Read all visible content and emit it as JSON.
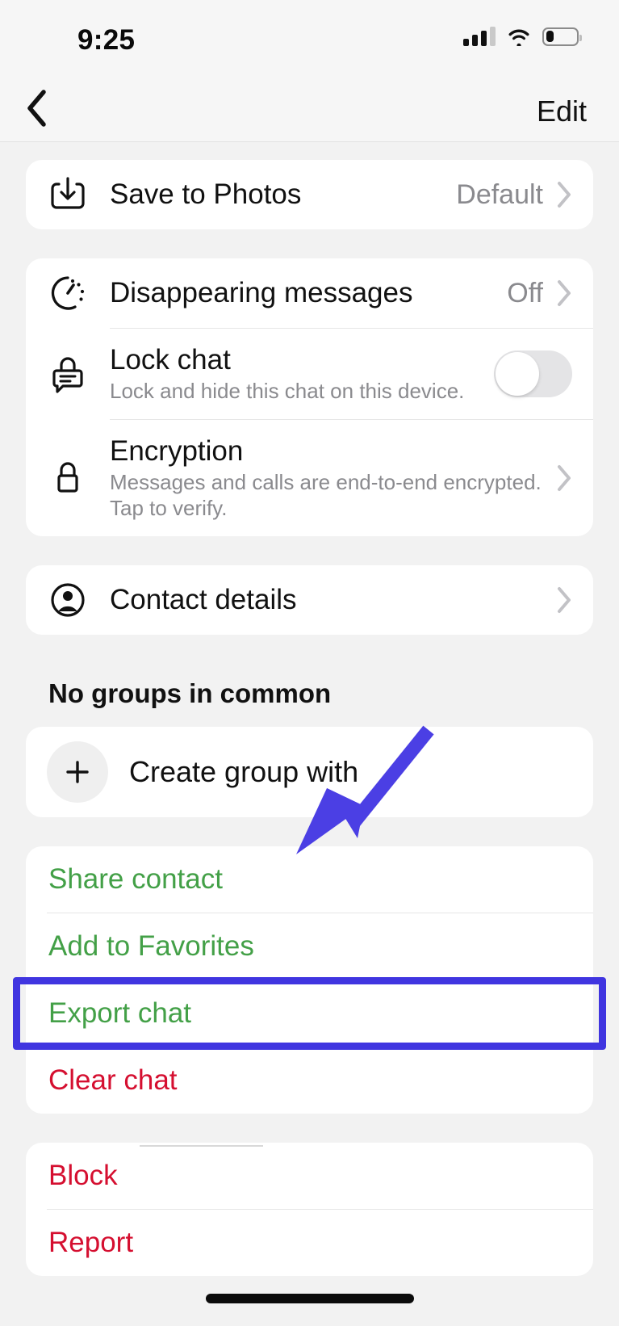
{
  "status_bar": {
    "time": "9:25",
    "icons": [
      "cellular-signal-icon",
      "wifi-icon",
      "battery-icon"
    ],
    "battery_level_percent": 25,
    "signal_bars_filled": 3,
    "signal_bars_total": 4
  },
  "nav_bar": {
    "back_icon": "chevron-left-icon",
    "edit_label": "Edit"
  },
  "sections": {
    "media": {
      "rows": [
        {
          "icon": "save-to-photos-icon",
          "title": "Save to Photos",
          "value": "Default",
          "accessory": "chevron-right-icon"
        }
      ]
    },
    "privacy": {
      "rows": [
        {
          "icon": "disappearing-messages-timer-icon",
          "title": "Disappearing messages",
          "value": "Off",
          "accessory": "chevron-right-icon"
        },
        {
          "icon": "lock-chat-icon",
          "title": "Lock chat",
          "subtitle": "Lock and hide this chat on this device.",
          "accessory": "toggle-switch",
          "toggle_state": "off"
        },
        {
          "icon": "encryption-lock-icon",
          "title": "Encryption",
          "subtitle": "Messages and calls are end-to-end encrypted. Tap to verify.",
          "accessory": "chevron-right-icon"
        }
      ]
    },
    "contact": {
      "rows": [
        {
          "icon": "contact-avatar-icon",
          "title": "Contact details",
          "accessory": "chevron-right-icon"
        }
      ]
    },
    "groups": {
      "header": "No groups in common",
      "rows": [
        {
          "icon": "plus-icon",
          "title": "Create group with"
        }
      ]
    },
    "actions": {
      "rows": [
        {
          "label": "Share contact",
          "style": "green"
        },
        {
          "label": "Add to Favorites",
          "style": "green"
        },
        {
          "label": "Export chat",
          "style": "green",
          "highlighted": true
        },
        {
          "label": "Clear chat",
          "style": "red"
        }
      ]
    },
    "danger": {
      "rows": [
        {
          "label": "Block",
          "style": "red"
        },
        {
          "label": "Report",
          "style": "red"
        }
      ]
    }
  },
  "annotation": {
    "highlight_color": "#4035e0",
    "arrow_color": "#4b3fe4",
    "target_label": "Export chat"
  },
  "colors": {
    "page_background": "#f2f2f2",
    "card_background": "#ffffff",
    "primary_text": "#111111",
    "secondary_text": "#8a8a8e",
    "green_action": "#43a047",
    "red_action": "#d50f30",
    "separator": "#e6e6e6"
  }
}
